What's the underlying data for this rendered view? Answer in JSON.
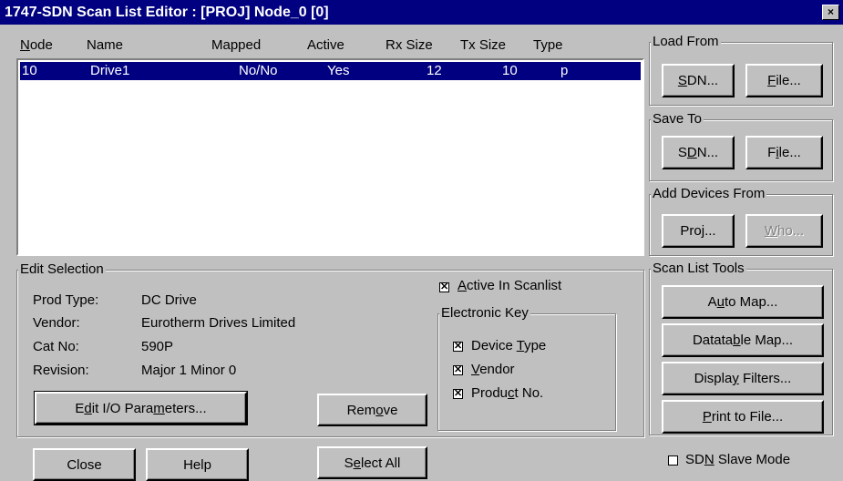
{
  "window": {
    "title": "1747-SDN Scan List Editor : [PROJ] Node_0 [0]",
    "close_glyph": "×"
  },
  "columns": [
    "Node",
    "Name",
    "Mapped",
    "Active",
    "Rx Size",
    "Tx Size",
    "Type"
  ],
  "rows": [
    {
      "node": "10",
      "name": "Drive1",
      "mapped": "No/No",
      "active": "Yes",
      "rx": "12",
      "tx": "10",
      "type": "p"
    }
  ],
  "load_from": {
    "label": "Load From",
    "sdn": "SDN...",
    "file": "File..."
  },
  "save_to": {
    "label": "Save To",
    "sdn": "SDN...",
    "file": "File..."
  },
  "add_devices": {
    "label": "Add Devices From",
    "proj": "Proj...",
    "who": "Who..."
  },
  "tools": {
    "label": "Scan List Tools",
    "auto_map": "Auto Map...",
    "datatable_map": "Datatable Map...",
    "display_filters": "Display Filters...",
    "print_to_file": "Print to File..."
  },
  "edit_selection": {
    "label": "Edit Selection",
    "fields": [
      {
        "label": "Prod Type:",
        "value": "DC Drive"
      },
      {
        "label": "Vendor:",
        "value": "Eurotherm Drives Limited"
      },
      {
        "label": "Cat No:",
        "value": "590P"
      },
      {
        "label": "Revision:",
        "value": "Major 1 Minor 0"
      }
    ],
    "active_in_scanlist": {
      "label": "Active In Scanlist",
      "checked": true
    },
    "electronic_key": {
      "label": "Electronic Key",
      "device_type": {
        "label": "Device Type",
        "checked": true
      },
      "vendor": {
        "label": "Vendor",
        "checked": true
      },
      "product_no": {
        "label": "Product No.",
        "checked": true
      }
    },
    "edit_io": "Edit I/O Parameters...",
    "remove": "Remove"
  },
  "bottom": {
    "close": "Close",
    "help": "Help",
    "select_all": "Select All",
    "sdn_slave_mode": {
      "label": "SDN Slave Mode",
      "checked": false
    }
  },
  "check_glyph": "✕"
}
